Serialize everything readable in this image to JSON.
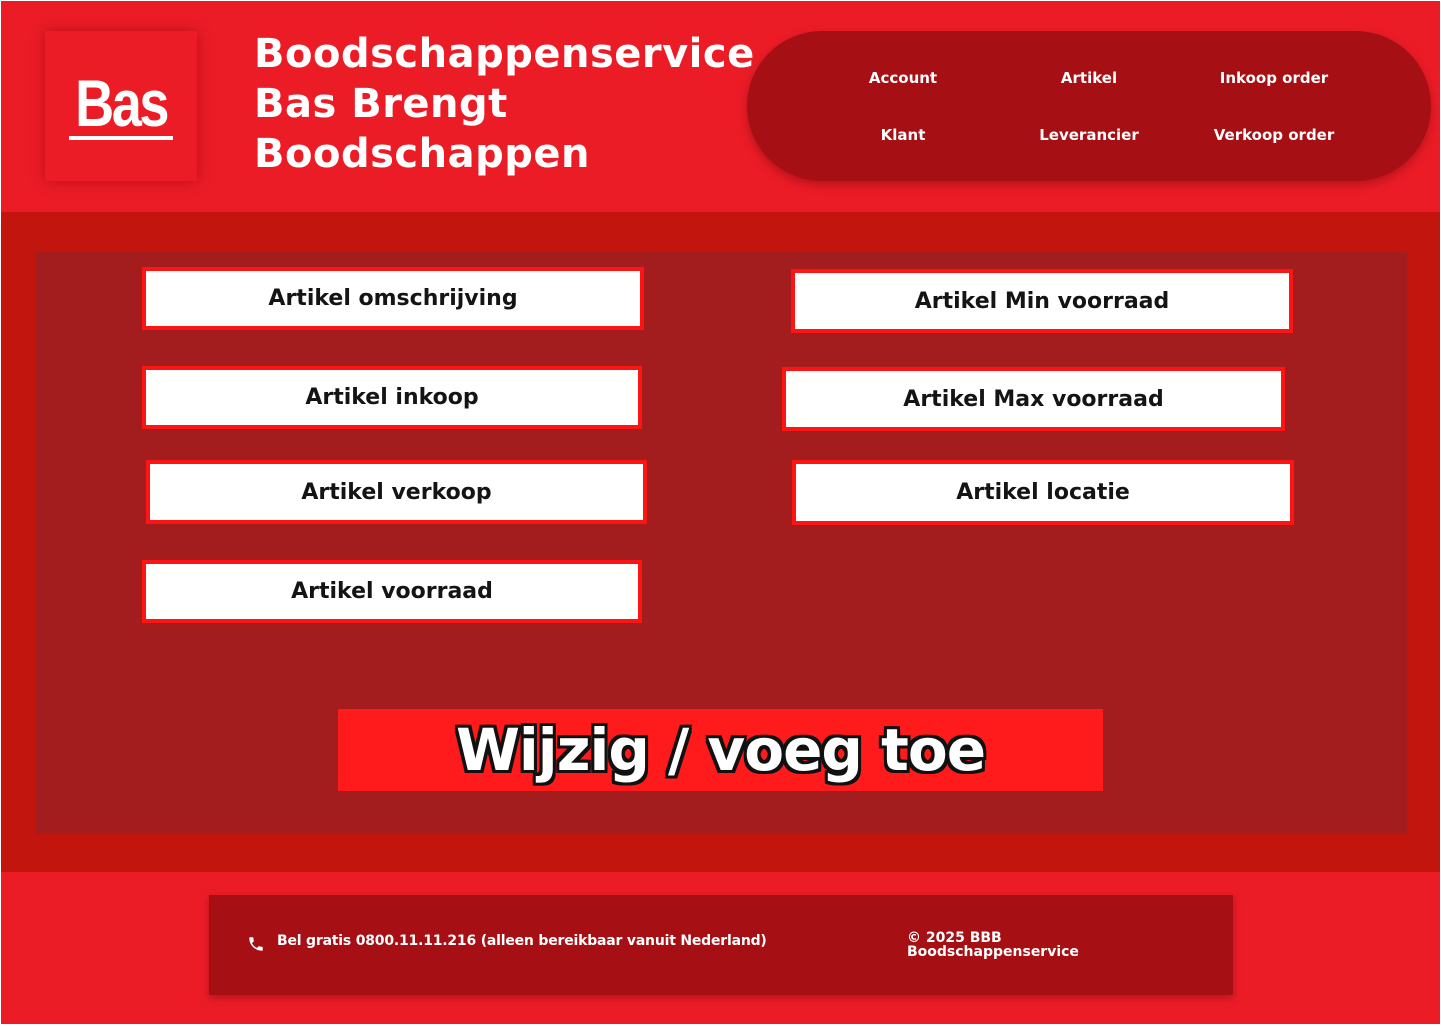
{
  "logo": {
    "text": "Bas"
  },
  "brand": {
    "title_lines": [
      "Boodschappenservice",
      "Bas Brengt",
      "Boodschappen"
    ]
  },
  "nav": {
    "items": [
      {
        "label": "Account"
      },
      {
        "label": "Artikel"
      },
      {
        "label": "Inkoop order"
      },
      {
        "label": "Klant"
      },
      {
        "label": "Leverancier"
      },
      {
        "label": "Verkoop order"
      }
    ]
  },
  "form": {
    "fields": {
      "omschrijving": "Artikel omschrijving",
      "inkoop": "Artikel inkoop",
      "verkoop": "Artikel verkoop",
      "voorraad": "Artikel voorraad",
      "min_voorraad": "Artikel Min voorraad",
      "max_voorraad": "Artikel Max voorraad",
      "locatie": "Artikel locatie"
    },
    "submit_label": "Wijzig / voeg toe"
  },
  "footer": {
    "phone_icon": "phone-icon",
    "phone_text": "Bel gratis 0800.11.11.216 (alleen bereikbaar vanuit Nederland)",
    "copyright": "© 2025 BBB Boodschappenservice"
  },
  "colors": {
    "brand_red": "#ec1c27",
    "dark_red": "#a60f14",
    "band_red": "#c1150e",
    "panel_red": "#a31d1f",
    "field_border": "#ff1414",
    "button_red": "#ff1b1b"
  }
}
